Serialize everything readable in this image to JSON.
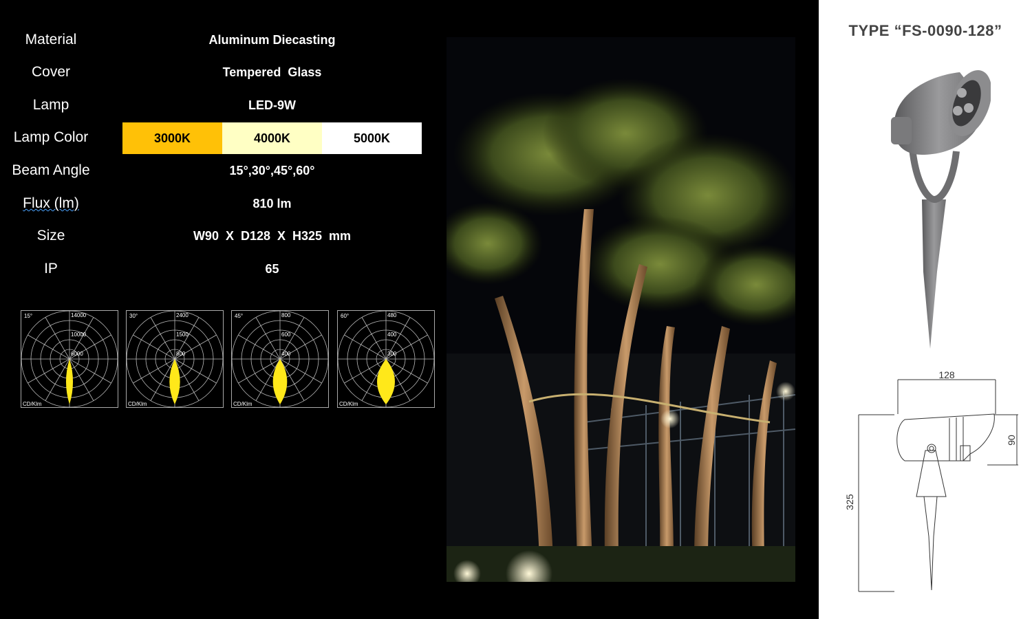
{
  "specs": [
    {
      "label": "Material",
      "value": "Aluminum Diecasting"
    },
    {
      "label": "Cover",
      "value": "Tempered  Glass"
    },
    {
      "label": "Lamp",
      "value": "LED-9W"
    },
    {
      "label": "Lamp Color",
      "value": ""
    },
    {
      "label": "Beam Angle",
      "value": "15°,30°,45°,60°"
    },
    {
      "label": "Flux (lm)",
      "value": "810 lm"
    },
    {
      "label": "Size",
      "value": "W90  X  D128  X  H325  mm"
    },
    {
      "label": "IP",
      "value": "65"
    }
  ],
  "lamp_colors": [
    {
      "label": "3000K",
      "color": "#ffc107"
    },
    {
      "label": "4000K",
      "color": "#ffffc4"
    },
    {
      "label": "5000K",
      "color": "#ffffff"
    }
  ],
  "polar_charts": [
    {
      "angle": "15°",
      "rings": [
        "14000",
        "10000",
        "6000"
      ],
      "unit": "CD/Klm",
      "beam": 15
    },
    {
      "angle": "30°",
      "rings": [
        "2400",
        "1500",
        "800"
      ],
      "unit": "CD/Klm",
      "beam": 30
    },
    {
      "angle": "45°",
      "rings": [
        "800",
        "600",
        "400"
      ],
      "unit": "CD/Klm",
      "beam": 45
    },
    {
      "angle": "60°",
      "rings": [
        "480",
        "400",
        "300"
      ],
      "unit": "CD/Klm",
      "beam": 60
    }
  ],
  "product": {
    "type_title": "TYPE “FS-0090-128”",
    "dim_width": "128",
    "dim_height_head": "90",
    "dim_total_height": "325"
  }
}
